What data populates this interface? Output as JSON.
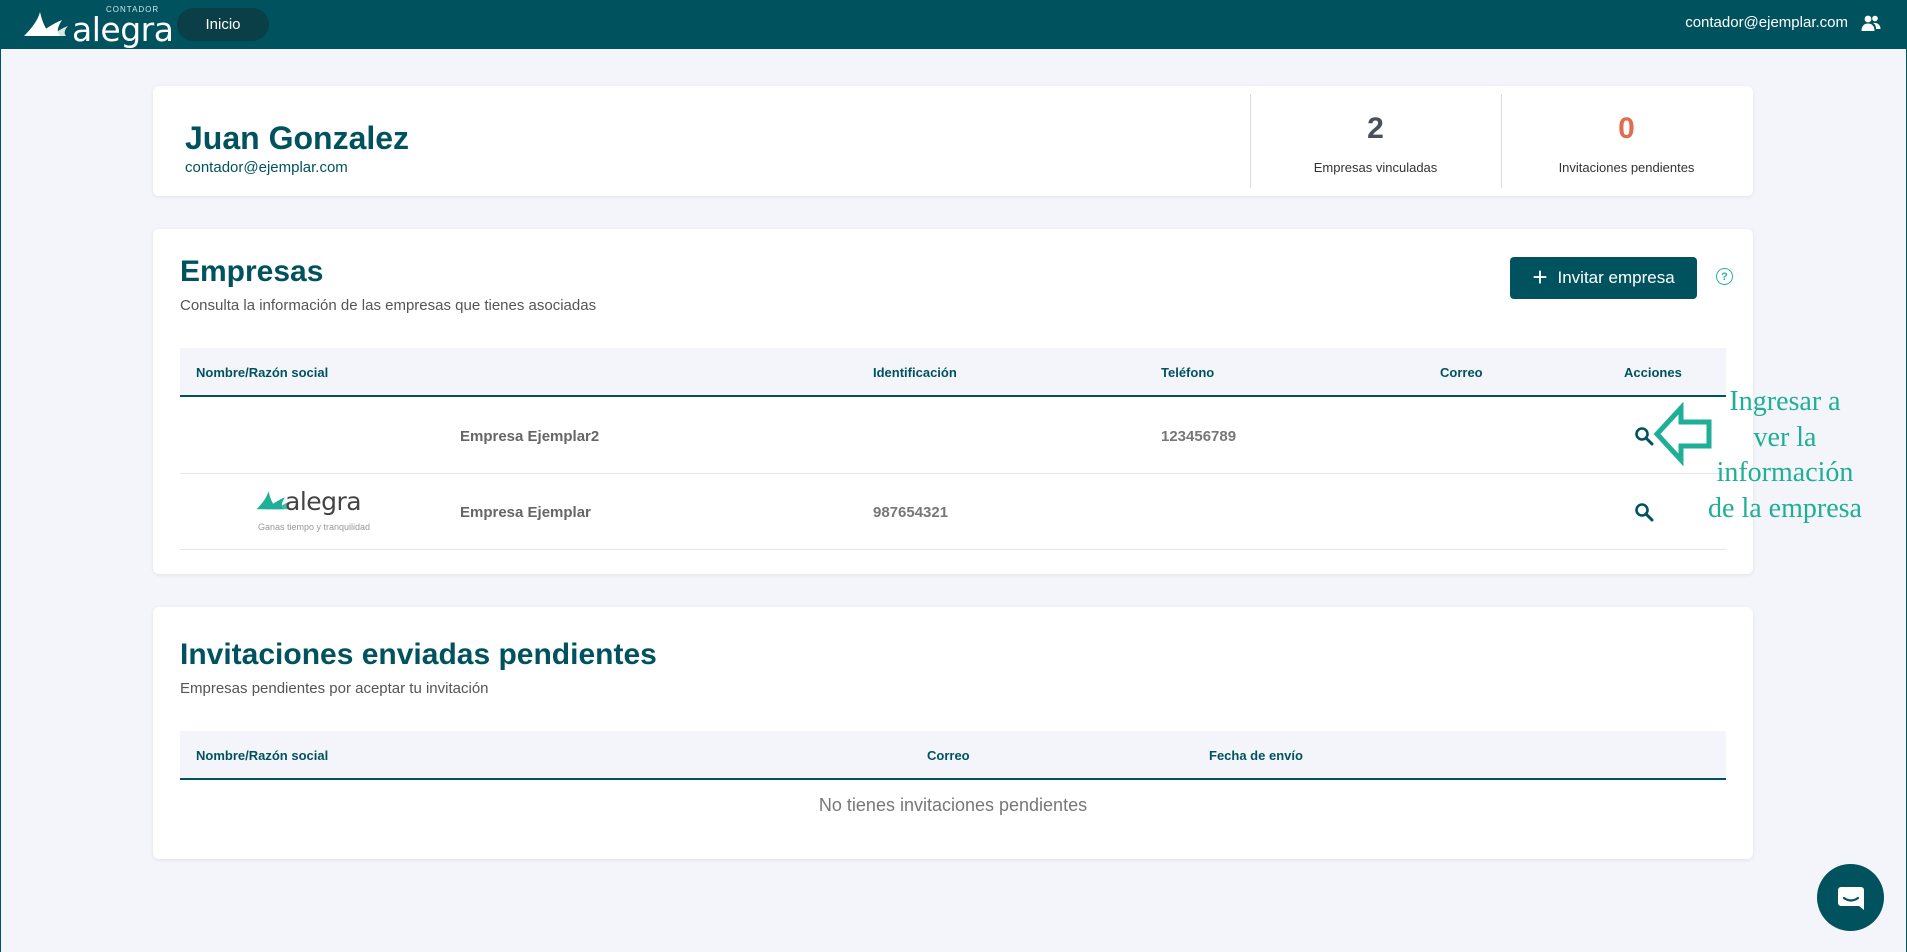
{
  "topbar": {
    "logo_tag": "CONTADOR",
    "logo_word": "alegra",
    "nav_home": "Inicio",
    "user_email": "contador@ejemplar.com",
    "user_icon": "users-icon"
  },
  "profile": {
    "name": "Juan Gonzalez",
    "email": "contador@ejemplar.com",
    "stats": [
      {
        "value": "2",
        "label": "Empresas vinculadas"
      },
      {
        "value": "0",
        "label": "Invitaciones pendientes"
      }
    ]
  },
  "companies": {
    "title": "Empresas",
    "subtitle": "Consulta la información de las empresas que tienes asociadas",
    "invite_button": "Invitar empresa",
    "help_icon": "?",
    "columns": [
      "Nombre/Razón social",
      "Identificación",
      "Teléfono",
      "Correo",
      "Acciones"
    ],
    "rows": [
      {
        "name": "Empresa Ejemplar2",
        "identification": "",
        "phone": "123456789",
        "email": "",
        "logo": ""
      },
      {
        "name": "Empresa Ejemplar",
        "identification": "987654321",
        "phone": "",
        "email": "",
        "logo": "alegra",
        "logo_sub": "Ganas tiempo y tranquilidad"
      }
    ]
  },
  "invites": {
    "title": "Invitaciones enviadas pendientes",
    "subtitle": "Empresas pendientes por aceptar tu invitación",
    "columns": [
      "Nombre/Razón social",
      "Correo",
      "Fecha de envío"
    ],
    "empty_message": "No tienes invitaciones pendientes"
  },
  "annotation": {
    "lines": [
      "Ingresar a",
      "ver la",
      "información",
      "de la empresa"
    ],
    "color": "#1fae96"
  },
  "colors": {
    "brand": "#00535e",
    "accent": "#2bb5a3",
    "pending": "#e06d4f"
  }
}
